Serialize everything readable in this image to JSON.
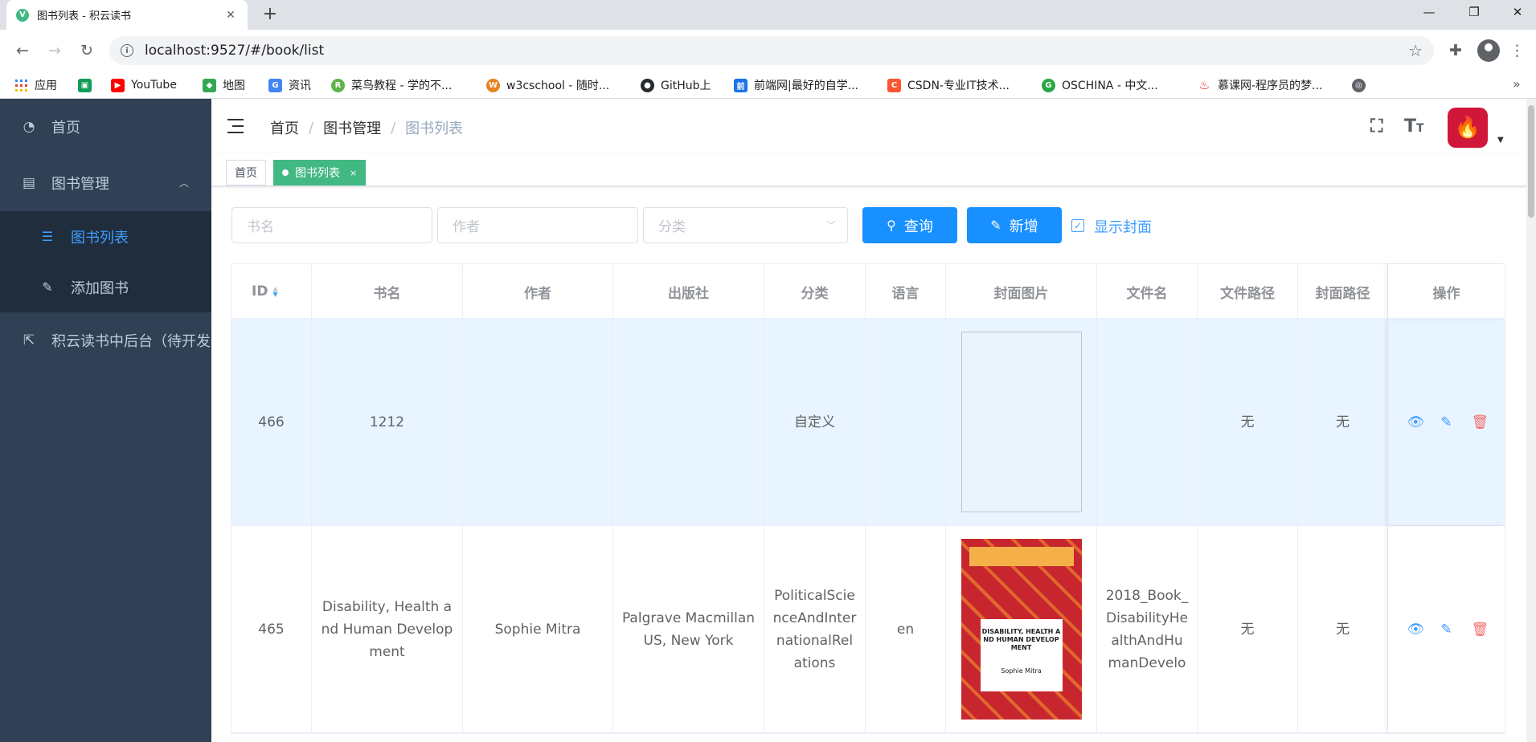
{
  "browser": {
    "tab_title": "图书列表 - 积云读书",
    "url": "localhost:9527/#/book/list",
    "bookmarks": [
      {
        "label": "应用",
        "color": "#ea4335"
      },
      {
        "label": "",
        "color": "#0f9d58"
      },
      {
        "label": "YouTube",
        "color": "#ff0000"
      },
      {
        "label": "地图",
        "color": "#34a853"
      },
      {
        "label": "资讯",
        "color": "#4285f4"
      },
      {
        "label": "菜鸟教程 - 学的不...",
        "color": "#5fb34a"
      },
      {
        "label": "w3cschool - 随时...",
        "color": "#e8821e"
      },
      {
        "label": "GitHub上",
        "color": "#24292e"
      },
      {
        "label": "前端网|最好的自学...",
        "color": "#1a73e8"
      },
      {
        "label": "CSDN-专业IT技术...",
        "color": "#fc5531"
      },
      {
        "label": "OSCHINA - 中文...",
        "color": "#28a745"
      },
      {
        "label": "慕课网-程序员的梦...",
        "color": "#f01414"
      }
    ]
  },
  "sidebar": {
    "items": [
      {
        "label": "首页",
        "icon": "dashboard-icon"
      },
      {
        "label": "图书管理",
        "icon": "document-icon"
      },
      {
        "label": "图书列表",
        "icon": "list-icon"
      },
      {
        "label": "添加图书",
        "icon": "edit-icon"
      },
      {
        "label": "积云读书中后台（待开发",
        "icon": "external-link-icon"
      }
    ]
  },
  "navbar": {
    "breadcrumb": [
      "首页",
      "图书管理",
      "图书列表"
    ]
  },
  "tags": {
    "home": "首页",
    "active": "图书列表",
    "close": "×"
  },
  "filter": {
    "title_placeholder": "书名",
    "author_placeholder": "作者",
    "category_placeholder": "分类",
    "search_label": "查询",
    "add_label": "新增",
    "show_cover_label": "显示封面",
    "show_cover_checked": true
  },
  "table": {
    "headers": [
      "ID",
      "书名",
      "作者",
      "出版社",
      "分类",
      "语言",
      "封面图片",
      "文件名",
      "文件路径",
      "封面路径",
      "操作"
    ],
    "rows": [
      {
        "id": "466",
        "title": "1212",
        "author": "",
        "publisher": "",
        "category": "自定义",
        "language": "",
        "cover": "",
        "filename": "",
        "filepath": "无",
        "coverpath": "无"
      },
      {
        "id": "465",
        "title": "Disability, Health and Human Development",
        "author": "Sophie Mitra",
        "publisher": "Palgrave Macmillan US, New York",
        "category": "PoliticalScienceAndInternationalRelations",
        "language": "en",
        "cover": "DISABILITY, HEALTH AND HUMAN DEVELOPMENT",
        "cover_author": "Sophie Mitra",
        "filename": "2018_Book_DisabilityHealthAndHumanDevelo",
        "filepath": "无",
        "coverpath": "无"
      }
    ]
  }
}
